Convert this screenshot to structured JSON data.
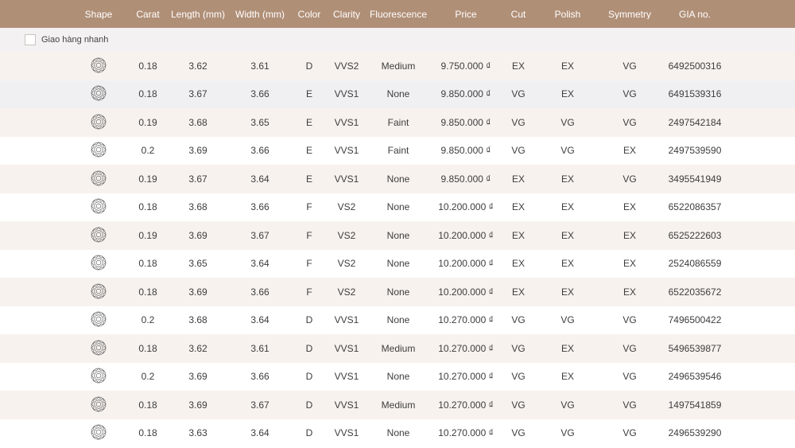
{
  "columns": [
    "Shape",
    "Carat",
    "Length (mm)",
    "Width (mm)",
    "Color",
    "Clarity",
    "Fluorescence",
    "Price",
    "Cut",
    "Polish",
    "Symmetry",
    "GIA no."
  ],
  "filter": {
    "label": "Giao hàng nhanh",
    "checked": false
  },
  "rows": [
    {
      "shape": "round-brilliant-icon",
      "carat": "0.18",
      "length": "3.62",
      "width": "3.61",
      "color": "D",
      "clarity": "VVS2",
      "fluorescence": "Medium",
      "price": "9.750.000 ₫",
      "cut": "EX",
      "polish": "EX",
      "symmetry": "VG",
      "gia": "6492500316"
    },
    {
      "shape": "round-brilliant-icon",
      "carat": "0.18",
      "length": "3.67",
      "width": "3.66",
      "color": "E",
      "clarity": "VVS1",
      "fluorescence": "None",
      "price": "9.850.000 ₫",
      "cut": "VG",
      "polish": "EX",
      "symmetry": "VG",
      "gia": "6491539316"
    },
    {
      "shape": "round-brilliant-icon",
      "carat": "0.19",
      "length": "3.68",
      "width": "3.65",
      "color": "E",
      "clarity": "VVS1",
      "fluorescence": "Faint",
      "price": "9.850.000 ₫",
      "cut": "VG",
      "polish": "VG",
      "symmetry": "VG",
      "gia": "2497542184"
    },
    {
      "shape": "round-brilliant-icon",
      "carat": "0.2",
      "length": "3.69",
      "width": "3.66",
      "color": "E",
      "clarity": "VVS1",
      "fluorescence": "Faint",
      "price": "9.850.000 ₫",
      "cut": "VG",
      "polish": "VG",
      "symmetry": "EX",
      "gia": "2497539590"
    },
    {
      "shape": "round-brilliant-icon",
      "carat": "0.19",
      "length": "3.67",
      "width": "3.64",
      "color": "E",
      "clarity": "VVS1",
      "fluorescence": "None",
      "price": "9.850.000 ₫",
      "cut": "EX",
      "polish": "EX",
      "symmetry": "VG",
      "gia": "3495541949"
    },
    {
      "shape": "round-brilliant-icon",
      "carat": "0.18",
      "length": "3.68",
      "width": "3.66",
      "color": "F",
      "clarity": "VS2",
      "fluorescence": "None",
      "price": "10.200.000 ₫",
      "cut": "EX",
      "polish": "EX",
      "symmetry": "EX",
      "gia": "6522086357"
    },
    {
      "shape": "round-brilliant-icon",
      "carat": "0.19",
      "length": "3.69",
      "width": "3.67",
      "color": "F",
      "clarity": "VS2",
      "fluorescence": "None",
      "price": "10.200.000 ₫",
      "cut": "EX",
      "polish": "EX",
      "symmetry": "EX",
      "gia": "6525222603"
    },
    {
      "shape": "round-brilliant-icon",
      "carat": "0.18",
      "length": "3.65",
      "width": "3.64",
      "color": "F",
      "clarity": "VS2",
      "fluorescence": "None",
      "price": "10.200.000 ₫",
      "cut": "EX",
      "polish": "EX",
      "symmetry": "EX",
      "gia": "2524086559"
    },
    {
      "shape": "round-brilliant-icon",
      "carat": "0.18",
      "length": "3.69",
      "width": "3.66",
      "color": "F",
      "clarity": "VS2",
      "fluorescence": "None",
      "price": "10.200.000 ₫",
      "cut": "EX",
      "polish": "EX",
      "symmetry": "EX",
      "gia": "6522035672"
    },
    {
      "shape": "round-brilliant-icon",
      "carat": "0.2",
      "length": "3.68",
      "width": "3.64",
      "color": "D",
      "clarity": "VVS1",
      "fluorescence": "None",
      "price": "10.270.000 ₫",
      "cut": "VG",
      "polish": "VG",
      "symmetry": "VG",
      "gia": "7496500422"
    },
    {
      "shape": "round-brilliant-icon",
      "carat": "0.18",
      "length": "3.62",
      "width": "3.61",
      "color": "D",
      "clarity": "VVS1",
      "fluorescence": "Medium",
      "price": "10.270.000 ₫",
      "cut": "VG",
      "polish": "EX",
      "symmetry": "VG",
      "gia": "5496539877"
    },
    {
      "shape": "round-brilliant-icon",
      "carat": "0.2",
      "length": "3.69",
      "width": "3.66",
      "color": "D",
      "clarity": "VVS1",
      "fluorescence": "None",
      "price": "10.270.000 ₫",
      "cut": "VG",
      "polish": "EX",
      "symmetry": "VG",
      "gia": "2496539546"
    },
    {
      "shape": "round-brilliant-icon",
      "carat": "0.18",
      "length": "3.69",
      "width": "3.67",
      "color": "D",
      "clarity": "VVS1",
      "fluorescence": "Medium",
      "price": "10.270.000 ₫",
      "cut": "VG",
      "polish": "VG",
      "symmetry": "VG",
      "gia": "1497541859"
    },
    {
      "shape": "round-brilliant-icon",
      "carat": "0.18",
      "length": "3.63",
      "width": "3.64",
      "color": "D",
      "clarity": "VVS1",
      "fluorescence": "None",
      "price": "10.270.000 ₫",
      "cut": "VG",
      "polish": "VG",
      "symmetry": "VG",
      "gia": "2496539290"
    }
  ],
  "colors": {
    "header_bg": "#b08f77",
    "row_alt_bg": "#f8f2ee",
    "row_hover_bg": "#f0f0f2",
    "filter_bg": "#f3f1f2"
  }
}
